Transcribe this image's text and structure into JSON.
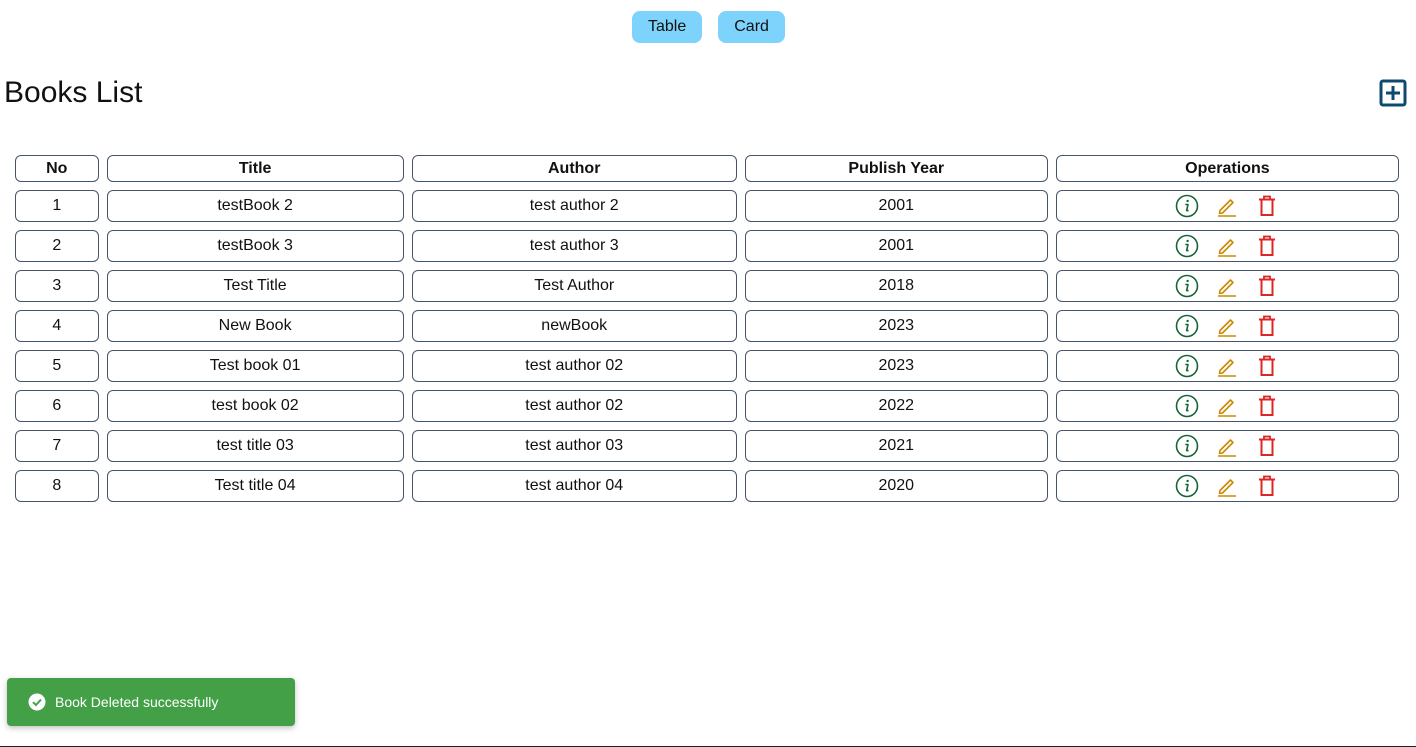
{
  "view_toggle": {
    "table_label": "Table",
    "card_label": "Card"
  },
  "header": {
    "title": "Books List",
    "add_icon": "plus-square-icon"
  },
  "table": {
    "columns": [
      "No",
      "Title",
      "Author",
      "Publish Year",
      "Operations"
    ],
    "rows": [
      {
        "no": "1",
        "title": "testBook 2",
        "author": "test author 2",
        "year": "2001"
      },
      {
        "no": "2",
        "title": "testBook 3",
        "author": "test author 3",
        "year": "2001"
      },
      {
        "no": "3",
        "title": "Test Title",
        "author": "Test Author",
        "year": "2018"
      },
      {
        "no": "4",
        "title": "New Book",
        "author": "newBook",
        "year": "2023"
      },
      {
        "no": "5",
        "title": "Test book 01",
        "author": "test author 02",
        "year": "2023"
      },
      {
        "no": "6",
        "title": "test book 02",
        "author": "test author 02",
        "year": "2022"
      },
      {
        "no": "7",
        "title": "test title 03",
        "author": "test author 03",
        "year": "2021"
      },
      {
        "no": "8",
        "title": "Test title 04",
        "author": "test author 04",
        "year": "2020"
      }
    ],
    "operation_icons": [
      "info-icon",
      "edit-icon",
      "delete-icon"
    ]
  },
  "toast": {
    "message": "Book Deleted successfully",
    "icon": "check-circle-icon"
  },
  "colors": {
    "toggle_bg": "#7dd3fc",
    "add_icon": "#0c4a6e",
    "info_icon": "#166534",
    "edit_icon": "#ca8a04",
    "delete_icon": "#dc2626",
    "toast_bg": "#43a047",
    "cell_border": "#475569"
  }
}
